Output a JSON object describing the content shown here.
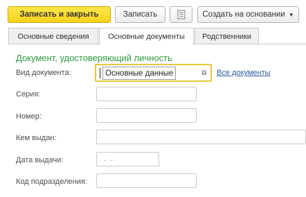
{
  "toolbar": {
    "save_close_label": "Записать и закрыть",
    "save_label": "Записать",
    "report_icon": "document-list-icon",
    "create_based_label": "Создать на основании"
  },
  "tabs": [
    {
      "label": "Основные сведения",
      "active": false
    },
    {
      "label": "Основные документы",
      "active": true
    },
    {
      "label": "Родственники",
      "active": false
    }
  ],
  "section": {
    "title": "Документ, удостоверяющий личность"
  },
  "form": {
    "doc_kind": {
      "label": "Вид документа:",
      "value": "Основные данные",
      "link": "Все документы"
    },
    "series": {
      "label": "Серия:",
      "value": ""
    },
    "number": {
      "label": "Номер:",
      "value": ""
    },
    "issued_by": {
      "label": "Кем выдан:",
      "value": ""
    },
    "issue_date": {
      "label": "Дата выдачи:",
      "value": ". ."
    },
    "dept_code": {
      "label": "Код подразделения:",
      "value": ""
    }
  },
  "colors": {
    "accent_green": "#2e9a3d",
    "primary_button": "#f7d21c",
    "focus_border": "#e6c83a",
    "link": "#2a5a9e"
  }
}
